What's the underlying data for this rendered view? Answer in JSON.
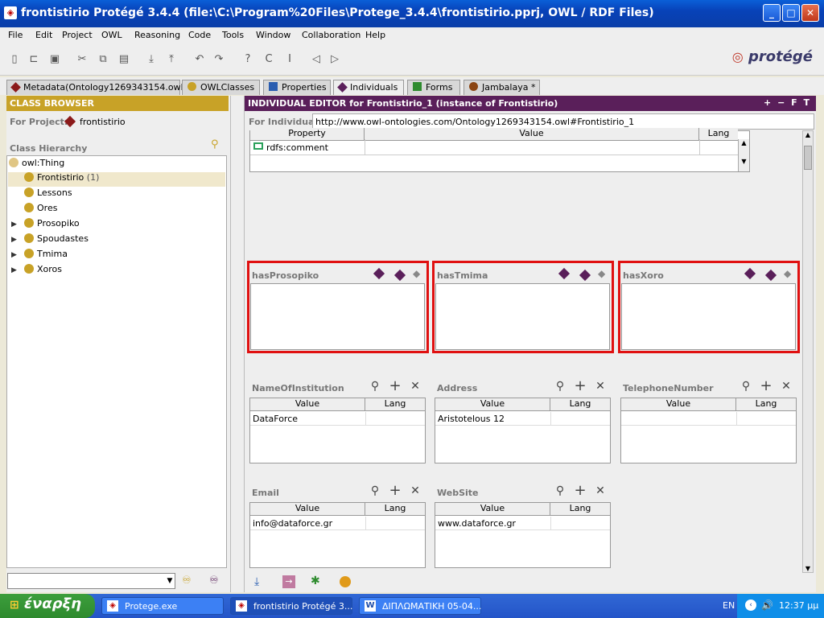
{
  "window": {
    "title": "frontistirio  Protégé 3.4.4     (file:\\C:\\Program%20Files\\Protege_3.4.4\\frontistirio.pprj, OWL / RDF Files)"
  },
  "menu": [
    "File",
    "Edit",
    "Project",
    "OWL",
    "Reasoning",
    "Code",
    "Tools",
    "Window",
    "Collaboration",
    "Help"
  ],
  "logo": "protégé",
  "tabs": [
    {
      "label": "Metadata(Ontology1269343154.owl)",
      "color": "#8b1a1a"
    },
    {
      "label": "OWLClasses",
      "color": "#c8a227"
    },
    {
      "label": "Properties",
      "color": "#2a5db0"
    },
    {
      "label": "Individuals",
      "color": "#5a1f5a"
    },
    {
      "label": "Forms",
      "color": "#2e8b2e"
    },
    {
      "label": "Jambalaya *",
      "color": "#8b4513"
    }
  ],
  "class_browser": {
    "header": "CLASS BROWSER",
    "for_project_label": "For Project:",
    "project_name": "frontistirio",
    "hierarchy_label": "Class Hierarchy",
    "root": "owl:Thing",
    "items": [
      {
        "label": "Frontistirio",
        "count": "(1)",
        "expandable": false,
        "selected": true
      },
      {
        "label": "Lessons",
        "count": "",
        "expandable": false,
        "selected": false
      },
      {
        "label": "Ores",
        "count": "",
        "expandable": false,
        "selected": false
      },
      {
        "label": "Prosopiko",
        "count": "",
        "expandable": true,
        "selected": false
      },
      {
        "label": "Spoudastes",
        "count": "",
        "expandable": true,
        "selected": false
      },
      {
        "label": "Tmima",
        "count": "",
        "expandable": true,
        "selected": false
      },
      {
        "label": "Xoros",
        "count": "",
        "expandable": true,
        "selected": false
      }
    ]
  },
  "editor": {
    "header": "INDIVIDUAL EDITOR for Frontistirio_1   (instance of Frontistirio)",
    "header_buttons": "+  −  F  T",
    "for_individual_label": "For Individual:",
    "individual_uri": "http://www.owl-ontologies.com/Ontology1269343154.owl#Frontistirio_1",
    "annotations": {
      "columns": [
        "Property",
        "Value",
        "Lang"
      ],
      "rows": [
        {
          "property": "rdfs:comment",
          "value": "",
          "lang": ""
        }
      ]
    },
    "object_props": [
      {
        "label": "hasProsopiko"
      },
      {
        "label": "hasTmima"
      },
      {
        "label": "hasXoro"
      }
    ],
    "datatype_props": [
      {
        "label": "NameOfInstitution",
        "value": "DataForce",
        "lang": ""
      },
      {
        "label": "Address",
        "value": "Aristotelous 12",
        "lang": ""
      },
      {
        "label": "TelephoneNumber",
        "value": "",
        "lang": ""
      },
      {
        "label": "Email",
        "value": "info@dataforce.gr",
        "lang": ""
      },
      {
        "label": "WebSite",
        "value": "www.dataforce.gr",
        "lang": ""
      }
    ],
    "value_col": "Value",
    "lang_col": "Lang"
  },
  "taskbar": {
    "start_label": "έναρξη",
    "tasks": [
      {
        "label": "Protege.exe",
        "active": false
      },
      {
        "label": "frontistirio  Protégé 3...",
        "active": true
      },
      {
        "label": "ΔΙΠΛΩΜΑΤΙΚΗ 05-04...",
        "active": false
      }
    ],
    "lang": "EN",
    "clock": "12:37 μμ"
  }
}
